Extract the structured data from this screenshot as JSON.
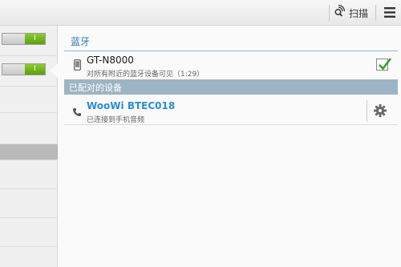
{
  "toolbar": {
    "scan_label": "扫描",
    "scan_icon": "scan-radar-icon",
    "menu_icon": "menu-icon"
  },
  "left_panel": {
    "toggles": [
      {
        "label": "I",
        "state": "on"
      },
      {
        "label": "I",
        "state": "on"
      }
    ]
  },
  "bluetooth": {
    "section_title": "蓝牙",
    "this_device": {
      "name": "GT-N8000",
      "status": "对所有附近的蓝牙设备可见（1:29）",
      "visible_checked": true
    },
    "paired_header": "已配对的设备",
    "paired_devices": [
      {
        "name": "WooWi BTEC018",
        "status": "已连接到手机音频",
        "icon": "phone-call-icon",
        "settings_icon": "gear-icon"
      }
    ]
  },
  "colors": {
    "accent": "#2a74b3",
    "paired_name": "#2a8ed4",
    "paired_header_bg": "#9db4c4",
    "toggle_on": "#6fb21a"
  }
}
